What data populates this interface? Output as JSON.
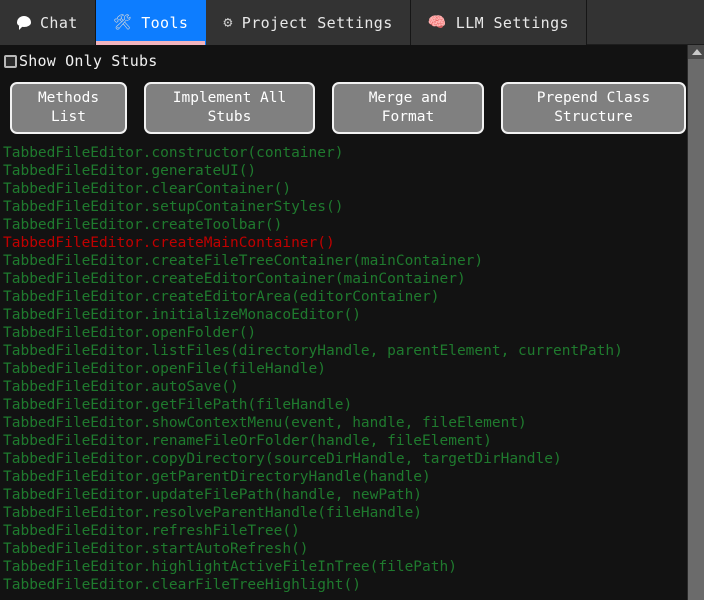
{
  "tabs": [
    {
      "label": "Chat",
      "icon": "chat-bubble-icon",
      "glyph": "",
      "active": false
    },
    {
      "label": "Tools",
      "icon": "hammer-wrench-icon",
      "glyph": "🛠",
      "active": true
    },
    {
      "label": "Project Settings",
      "icon": "gear-icon",
      "glyph": "⚙",
      "active": false
    },
    {
      "label": "LLM Settings",
      "icon": "brain-icon",
      "glyph": "🧠",
      "active": false
    }
  ],
  "filters": {
    "show_only_stubs_label": "Show Only Stubs",
    "show_only_stubs_checked": false
  },
  "toolbar": {
    "methods_list_label": "Methods\nList",
    "implement_all_stubs_label": "Implement All\nStubs",
    "merge_and_format_label": "Merge and\nFormat",
    "prepend_class_structure_label": "Prepend Class\nStructure"
  },
  "colors": {
    "active_tab_bg": "#0d7dff",
    "active_tab_underline": "#f0b3bd",
    "tabbar_bg": "#333333",
    "panel_bg": "#121212",
    "button_bg": "#808080",
    "method_green": "#1f7a2e",
    "method_red": "#c00000",
    "scrollbar_thumb": "#6b6b6b",
    "brain_icon_pink": "#ff3fb0"
  },
  "methods": [
    {
      "text": "TabbedFileEditor.constructor(container)",
      "stub": false
    },
    {
      "text": "TabbedFileEditor.generateUI()",
      "stub": false
    },
    {
      "text": "TabbedFileEditor.clearContainer()",
      "stub": false
    },
    {
      "text": "TabbedFileEditor.setupContainerStyles()",
      "stub": false
    },
    {
      "text": "TabbedFileEditor.createToolbar()",
      "stub": false
    },
    {
      "text": "TabbedFileEditor.createMainContainer()",
      "stub": true
    },
    {
      "text": "TabbedFileEditor.createFileTreeContainer(mainContainer)",
      "stub": false
    },
    {
      "text": "TabbedFileEditor.createEditorContainer(mainContainer)",
      "stub": false
    },
    {
      "text": "TabbedFileEditor.createEditorArea(editorContainer)",
      "stub": false
    },
    {
      "text": "TabbedFileEditor.initializeMonacoEditor()",
      "stub": false
    },
    {
      "text": "TabbedFileEditor.openFolder()",
      "stub": false
    },
    {
      "text": "TabbedFileEditor.listFiles(directoryHandle, parentElement, currentPath)",
      "stub": false
    },
    {
      "text": "TabbedFileEditor.openFile(fileHandle)",
      "stub": false
    },
    {
      "text": "TabbedFileEditor.autoSave()",
      "stub": false
    },
    {
      "text": "TabbedFileEditor.getFilePath(fileHandle)",
      "stub": false
    },
    {
      "text": "TabbedFileEditor.showContextMenu(event, handle, fileElement)",
      "stub": false
    },
    {
      "text": "TabbedFileEditor.renameFileOrFolder(handle, fileElement)",
      "stub": false
    },
    {
      "text": "TabbedFileEditor.copyDirectory(sourceDirHandle, targetDirHandle)",
      "stub": false
    },
    {
      "text": "TabbedFileEditor.getParentDirectoryHandle(handle)",
      "stub": false
    },
    {
      "text": "TabbedFileEditor.updateFilePath(handle, newPath)",
      "stub": false
    },
    {
      "text": "TabbedFileEditor.resolveParentHandle(fileHandle)",
      "stub": false
    },
    {
      "text": "TabbedFileEditor.refreshFileTree()",
      "stub": false
    },
    {
      "text": "TabbedFileEditor.startAutoRefresh()",
      "stub": false
    },
    {
      "text": "TabbedFileEditor.highlightActiveFileInTree(filePath)",
      "stub": false
    },
    {
      "text": "TabbedFileEditor.clearFileTreeHighlight()",
      "stub": false
    }
  ]
}
